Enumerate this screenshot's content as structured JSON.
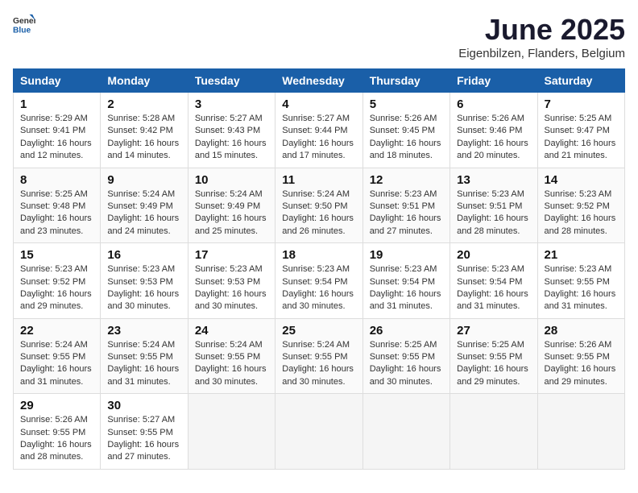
{
  "header": {
    "logo_general": "General",
    "logo_blue": "Blue",
    "month_title": "June 2025",
    "subtitle": "Eigenbilzen, Flanders, Belgium"
  },
  "weekdays": [
    "Sunday",
    "Monday",
    "Tuesday",
    "Wednesday",
    "Thursday",
    "Friday",
    "Saturday"
  ],
  "days": [
    {
      "day": "",
      "empty": true
    },
    {
      "day": "2",
      "sunrise": "Sunrise: 5:28 AM",
      "sunset": "Sunset: 9:42 PM",
      "daylight": "Daylight: 16 hours and 14 minutes."
    },
    {
      "day": "3",
      "sunrise": "Sunrise: 5:27 AM",
      "sunset": "Sunset: 9:43 PM",
      "daylight": "Daylight: 16 hours and 15 minutes."
    },
    {
      "day": "4",
      "sunrise": "Sunrise: 5:27 AM",
      "sunset": "Sunset: 9:44 PM",
      "daylight": "Daylight: 16 hours and 17 minutes."
    },
    {
      "day": "5",
      "sunrise": "Sunrise: 5:26 AM",
      "sunset": "Sunset: 9:45 PM",
      "daylight": "Daylight: 16 hours and 18 minutes."
    },
    {
      "day": "6",
      "sunrise": "Sunrise: 5:26 AM",
      "sunset": "Sunset: 9:46 PM",
      "daylight": "Daylight: 16 hours and 20 minutes."
    },
    {
      "day": "7",
      "sunrise": "Sunrise: 5:25 AM",
      "sunset": "Sunset: 9:47 PM",
      "daylight": "Daylight: 16 hours and 21 minutes."
    },
    {
      "day": "8",
      "sunrise": "Sunrise: 5:25 AM",
      "sunset": "Sunset: 9:48 PM",
      "daylight": "Daylight: 16 hours and 23 minutes."
    },
    {
      "day": "9",
      "sunrise": "Sunrise: 5:24 AM",
      "sunset": "Sunset: 9:49 PM",
      "daylight": "Daylight: 16 hours and 24 minutes."
    },
    {
      "day": "10",
      "sunrise": "Sunrise: 5:24 AM",
      "sunset": "Sunset: 9:49 PM",
      "daylight": "Daylight: 16 hours and 25 minutes."
    },
    {
      "day": "11",
      "sunrise": "Sunrise: 5:24 AM",
      "sunset": "Sunset: 9:50 PM",
      "daylight": "Daylight: 16 hours and 26 minutes."
    },
    {
      "day": "12",
      "sunrise": "Sunrise: 5:23 AM",
      "sunset": "Sunset: 9:51 PM",
      "daylight": "Daylight: 16 hours and 27 minutes."
    },
    {
      "day": "13",
      "sunrise": "Sunrise: 5:23 AM",
      "sunset": "Sunset: 9:51 PM",
      "daylight": "Daylight: 16 hours and 28 minutes."
    },
    {
      "day": "14",
      "sunrise": "Sunrise: 5:23 AM",
      "sunset": "Sunset: 9:52 PM",
      "daylight": "Daylight: 16 hours and 28 minutes."
    },
    {
      "day": "15",
      "sunrise": "Sunrise: 5:23 AM",
      "sunset": "Sunset: 9:52 PM",
      "daylight": "Daylight: 16 hours and 29 minutes."
    },
    {
      "day": "16",
      "sunrise": "Sunrise: 5:23 AM",
      "sunset": "Sunset: 9:53 PM",
      "daylight": "Daylight: 16 hours and 30 minutes."
    },
    {
      "day": "17",
      "sunrise": "Sunrise: 5:23 AM",
      "sunset": "Sunset: 9:53 PM",
      "daylight": "Daylight: 16 hours and 30 minutes."
    },
    {
      "day": "18",
      "sunrise": "Sunrise: 5:23 AM",
      "sunset": "Sunset: 9:54 PM",
      "daylight": "Daylight: 16 hours and 30 minutes."
    },
    {
      "day": "19",
      "sunrise": "Sunrise: 5:23 AM",
      "sunset": "Sunset: 9:54 PM",
      "daylight": "Daylight: 16 hours and 31 minutes."
    },
    {
      "day": "20",
      "sunrise": "Sunrise: 5:23 AM",
      "sunset": "Sunset: 9:54 PM",
      "daylight": "Daylight: 16 hours and 31 minutes."
    },
    {
      "day": "21",
      "sunrise": "Sunrise: 5:23 AM",
      "sunset": "Sunset: 9:55 PM",
      "daylight": "Daylight: 16 hours and 31 minutes."
    },
    {
      "day": "22",
      "sunrise": "Sunrise: 5:24 AM",
      "sunset": "Sunset: 9:55 PM",
      "daylight": "Daylight: 16 hours and 31 minutes."
    },
    {
      "day": "23",
      "sunrise": "Sunrise: 5:24 AM",
      "sunset": "Sunset: 9:55 PM",
      "daylight": "Daylight: 16 hours and 31 minutes."
    },
    {
      "day": "24",
      "sunrise": "Sunrise: 5:24 AM",
      "sunset": "Sunset: 9:55 PM",
      "daylight": "Daylight: 16 hours and 30 minutes."
    },
    {
      "day": "25",
      "sunrise": "Sunrise: 5:24 AM",
      "sunset": "Sunset: 9:55 PM",
      "daylight": "Daylight: 16 hours and 30 minutes."
    },
    {
      "day": "26",
      "sunrise": "Sunrise: 5:25 AM",
      "sunset": "Sunset: 9:55 PM",
      "daylight": "Daylight: 16 hours and 30 minutes."
    },
    {
      "day": "27",
      "sunrise": "Sunrise: 5:25 AM",
      "sunset": "Sunset: 9:55 PM",
      "daylight": "Daylight: 16 hours and 29 minutes."
    },
    {
      "day": "28",
      "sunrise": "Sunrise: 5:26 AM",
      "sunset": "Sunset: 9:55 PM",
      "daylight": "Daylight: 16 hours and 29 minutes."
    },
    {
      "day": "29",
      "sunrise": "Sunrise: 5:26 AM",
      "sunset": "Sunset: 9:55 PM",
      "daylight": "Daylight: 16 hours and 28 minutes."
    },
    {
      "day": "30",
      "sunrise": "Sunrise: 5:27 AM",
      "sunset": "Sunset: 9:55 PM",
      "daylight": "Daylight: 16 hours and 27 minutes."
    },
    {
      "day": "1",
      "is_first": true,
      "sunrise": "Sunrise: 5:29 AM",
      "sunset": "Sunset: 9:41 PM",
      "daylight": "Daylight: 16 hours and 12 minutes."
    }
  ]
}
